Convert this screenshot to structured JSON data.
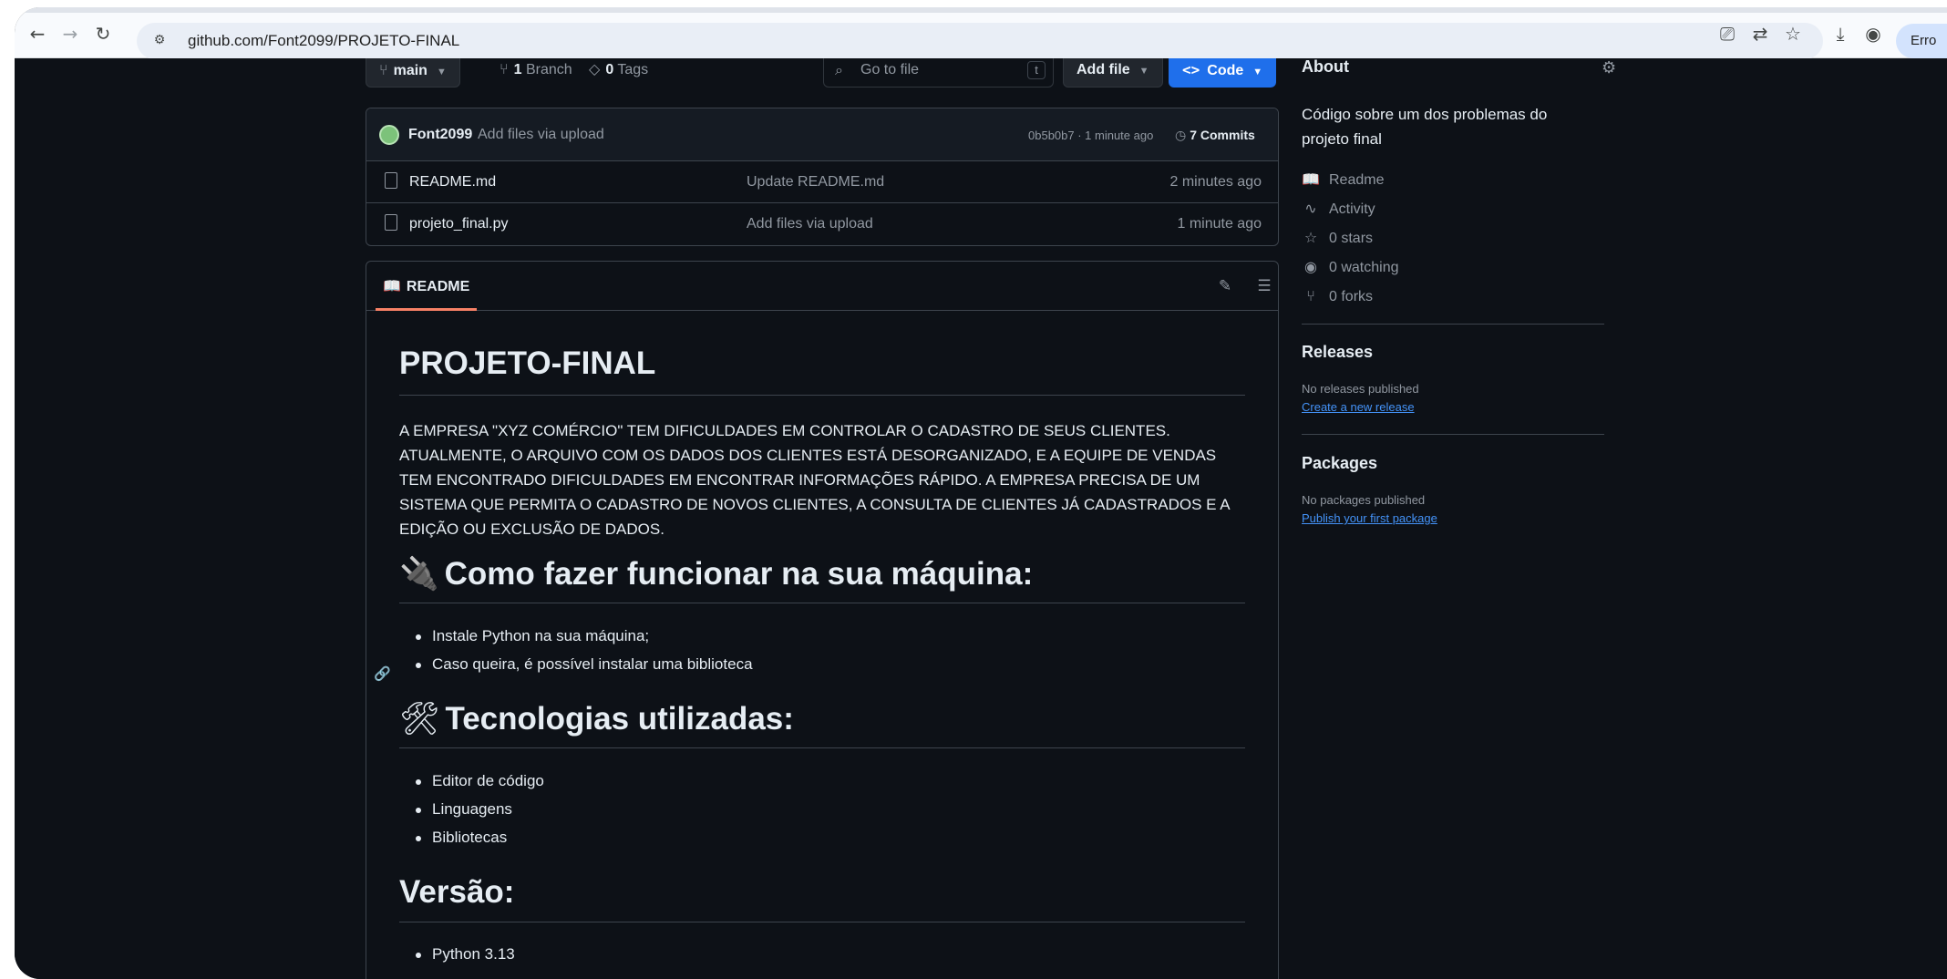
{
  "browser": {
    "url": "github.com/Font2099/PROJETO-FINAL",
    "profile_label": "Erro"
  },
  "toolbar": {
    "branch": "main",
    "branch_count": "1",
    "branch_label": "Branch",
    "tag_count": "0",
    "tag_label": "Tags",
    "goto_placeholder": "Go to file",
    "goto_shortcut": "t",
    "add_file": "Add file",
    "code": "Code"
  },
  "commit": {
    "author": "Font2099",
    "message": "Add files via upload",
    "hash_time": "0b5b0b7 · 1 minute ago",
    "commits": "7 Commits"
  },
  "files": [
    {
      "name": "README.md",
      "commit": "Update README.md",
      "time": "2 minutes ago"
    },
    {
      "name": "projeto_final.py",
      "commit": "Add files via upload",
      "time": "1 minute ago"
    }
  ],
  "readme": {
    "tab": "README",
    "title": "PROJETO-FINAL",
    "paragraph": "A EMPRESA \"XYZ COMÉRCIO\" TEM DIFICULDADES EM CONTROLAR O CADASTRO DE SEUS CLIENTES. ATUALMENTE, O ARQUIVO COM OS DADOS DOS CLIENTES ESTÁ DESORGANIZADO, E A EQUIPE DE VENDAS TEM ENCONTRADO DIFICULDADES EM ENCONTRAR INFORMAÇÕES RÁPIDO. A EMPRESA PRECISA DE UM SISTEMA QUE PERMITA O CADASTRO DE NOVOS CLIENTES, A CONSULTA DE CLIENTES JÁ CADASTRADOS E A EDIÇÃO OU EXCLUSÃO DE DADOS.",
    "section1": {
      "emoji": "🔌",
      "title": "Como fazer funcionar na sua máquina:",
      "items": [
        "Instale Python na sua máquina;",
        "Caso queira, é possível instalar uma biblioteca"
      ]
    },
    "section2": {
      "emoji": "🛠",
      "title": "Tecnologias utilizadas:",
      "items": [
        "Editor de código",
        "Linguagens",
        "Bibliotecas"
      ]
    },
    "section3": {
      "title": "Versão:",
      "items": [
        "Python 3.13"
      ]
    }
  },
  "sidebar": {
    "about_title": "About",
    "about_desc": "Código sobre um dos problemas do projeto final",
    "readme": "Readme",
    "activity": "Activity",
    "stars": "0 stars",
    "watching": "0 watching",
    "forks": "0 forks",
    "releases_title": "Releases",
    "releases_none": "No releases published",
    "releases_link": "Create a new release",
    "packages_title": "Packages",
    "packages_none": "No packages published",
    "packages_link": "Publish your first package"
  },
  "icons": {
    "back": "arrow-left-icon",
    "forward": "arrow-right-icon",
    "reload": "reload-icon"
  },
  "colors": {
    "background": "#0d1117",
    "accent": "#1f6feb",
    "link": "#4493f8",
    "tab_underline": "#f78166"
  }
}
